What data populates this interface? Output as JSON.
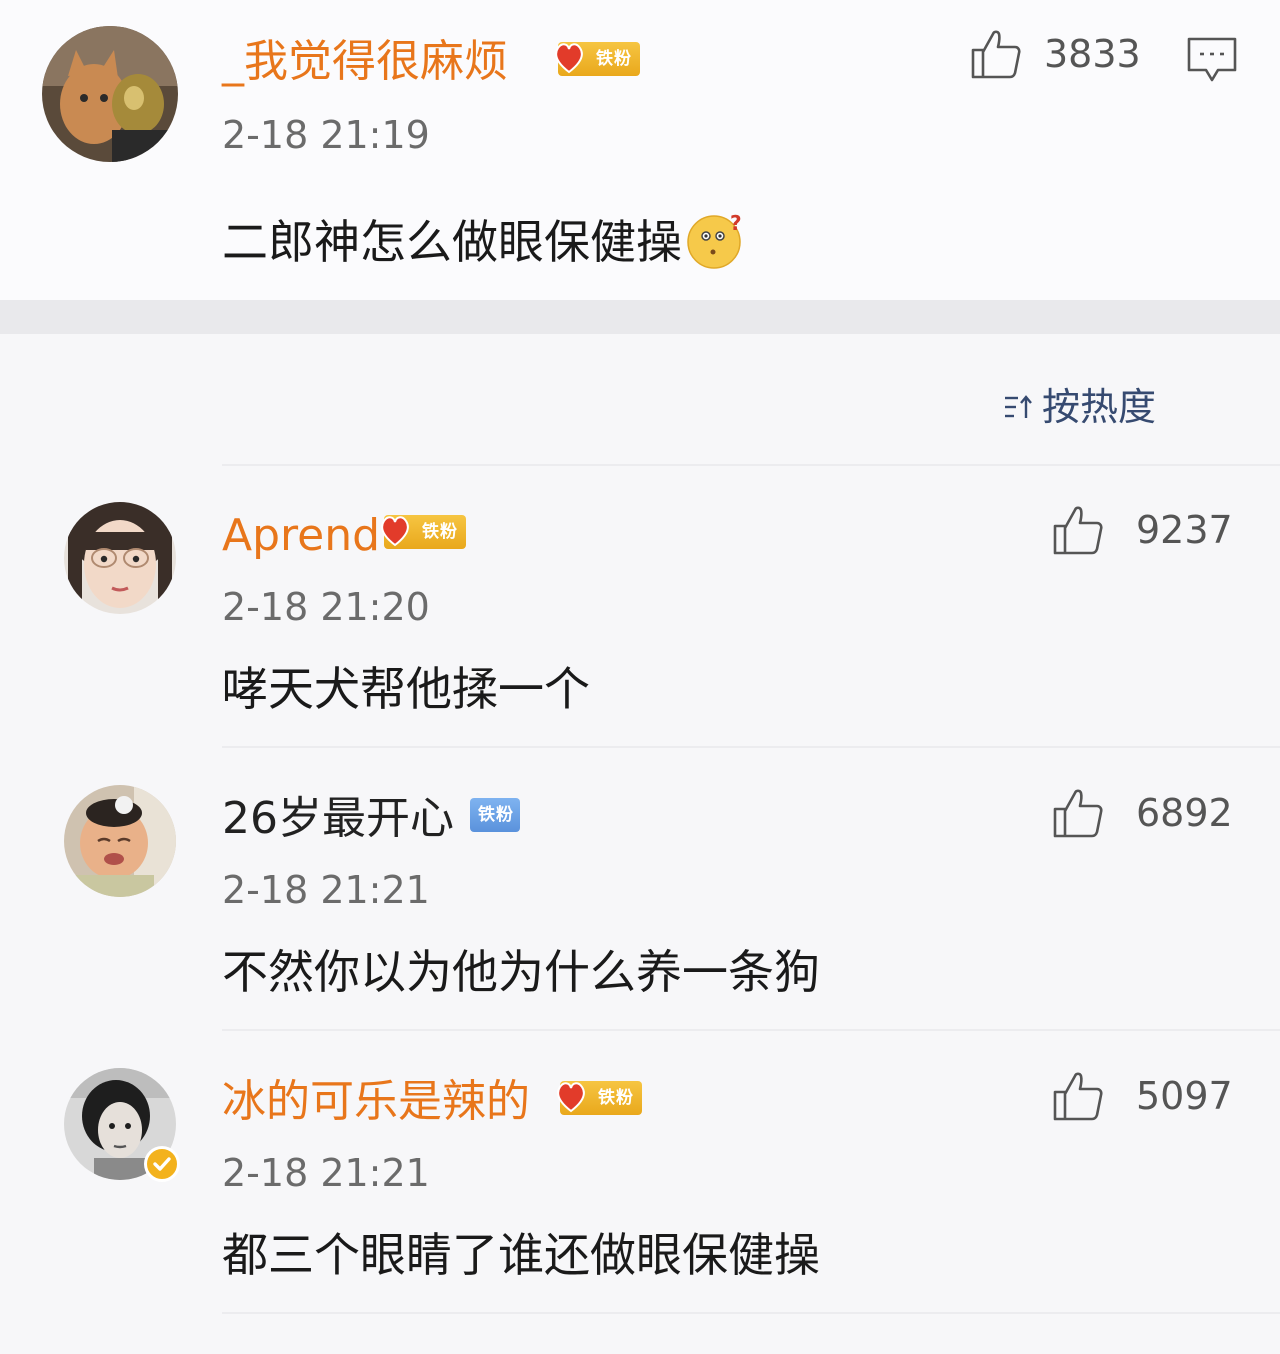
{
  "post": {
    "username": "_我觉得很麻烦",
    "badge": "铁粉",
    "timestamp": "2-18 21:19",
    "content": "二郎神怎么做眼保健操",
    "emoji": "thinking-face-emoji",
    "likes": "3833",
    "comment_icon": "comment-icon"
  },
  "sort": {
    "label": "按热度",
    "icon": "sort-icon"
  },
  "comments": [
    {
      "username": "Aprend",
      "badge": "铁粉",
      "timestamp": "2-18 21:20",
      "content": "哮天犬帮他揉一个",
      "likes": "9237"
    },
    {
      "username": "26岁最开心",
      "badge": "铁粉",
      "timestamp": "2-18 21:21",
      "content": "不然你以为他为什么养一条狗",
      "likes": "6892"
    },
    {
      "username": "冰的可乐是辣的",
      "badge": "铁粉",
      "timestamp": "2-18 21:21",
      "content": "都三个眼睛了谁还做眼保健操",
      "likes": "5097"
    }
  ],
  "colors": {
    "username_vip": "#e8761b",
    "username_normal": "#222222",
    "badge_gold": "#f0b52e",
    "badge_blue": "#6a9fe6",
    "sort_text": "#364a70",
    "timestamp": "#6b6b6b"
  }
}
